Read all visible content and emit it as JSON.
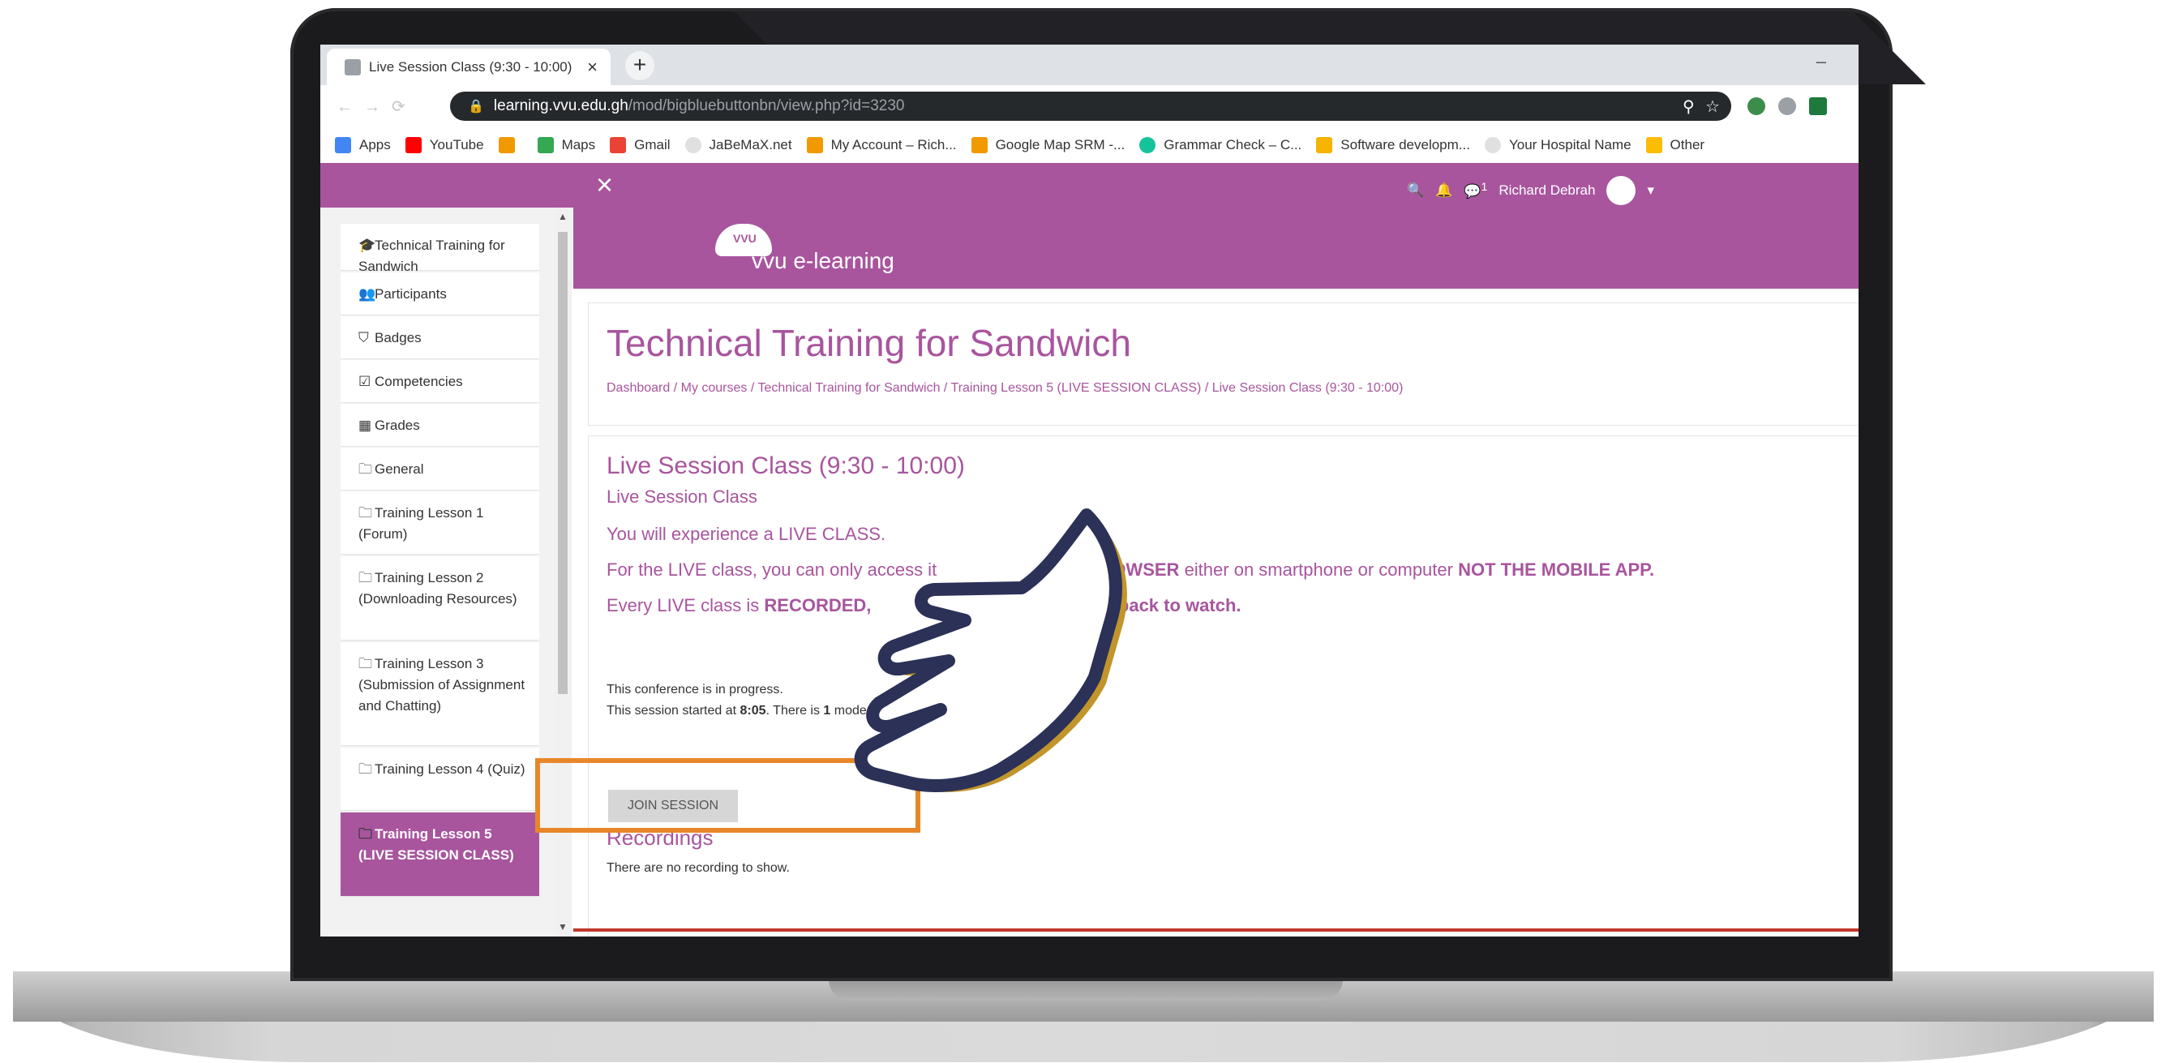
{
  "browser": {
    "tab_title": "Live Session Class (9:30 - 10:00)",
    "tab_close": "×",
    "new_tab": "+",
    "minimize": "–",
    "url_host": "learning.vvu.edu.gh",
    "url_path": "/mod/bigbluebuttonbn/view.php?id=3230",
    "bookmarks": [
      "Apps",
      "YouTube",
      "",
      "Maps",
      "Gmail",
      "JaBeMaX.net",
      "My Account – Rich...",
      "Google Map SRM -...",
      "Grammar Check – C...",
      "Software developm...",
      "Your Hospital Name",
      "Other"
    ]
  },
  "header": {
    "close_icon": "×",
    "user_name": "Richard Debrah",
    "message_count": "1"
  },
  "sidebar": {
    "items": [
      {
        "icon": "graduation-cap-icon",
        "label": "Technical Training for Sandwich"
      },
      {
        "icon": "users-icon",
        "label": "Participants"
      },
      {
        "icon": "shield-icon",
        "label": "Badges"
      },
      {
        "icon": "check-square-icon",
        "label": "Competencies"
      },
      {
        "icon": "table-icon",
        "label": "Grades"
      },
      {
        "icon": "folder-icon",
        "label": "General"
      },
      {
        "icon": "folder-icon",
        "label": "Training Lesson 1 (Forum)"
      },
      {
        "icon": "folder-icon",
        "label": "Training Lesson 2 (Downloading Resources)"
      },
      {
        "icon": "folder-icon",
        "label": "Training Lesson 3 (Submission of Assignment and Chatting)"
      },
      {
        "icon": "folder-icon",
        "label": "Training Lesson 4 (Quiz)"
      },
      {
        "icon": "folder-icon",
        "label": "Training Lesson 5 (LIVE SESSION CLASS)"
      }
    ]
  },
  "banner": {
    "logo_text": "vvu e-learning",
    "logo_badge": "VVU"
  },
  "page": {
    "course_title": "Technical Training for Sandwich",
    "breadcrumb": "Dashboard / My courses / Technical Training for Sandwich / Training Lesson 5 (LIVE SESSION CLASS) / Live Session Class (9:30 - 10:00)"
  },
  "activity": {
    "title": "Live Session Class (9:30 - 10:00)",
    "subtitle": "Live Session Class",
    "line1": "You will experience a LIVE CLASS.",
    "line2_a": "For the LIVE class, you can only access it",
    "line2_b": "OWSER",
    "line2_c": "either on smartphone or computer",
    "line2_d": "NOT THE MOBILE APP.",
    "line3_a": "Every LIVE class is",
    "line3_b": "RECORDED,",
    "line3_c": "e back to watch.",
    "status1": "This conference is in progress.",
    "status2_a": "This session started at",
    "status2_time": "8:05",
    "status2_b": ". There is",
    "status2_count": "1",
    "status2_c": "modera",
    "join_button": "JOIN SESSION",
    "recordings_title": "Recordings",
    "recordings_none": "There are no recording to show."
  },
  "colors": {
    "accent": "#a8559e",
    "highlight": "#e8872a",
    "hand": "#2b3157",
    "hand_shadow": "#c1952b"
  }
}
